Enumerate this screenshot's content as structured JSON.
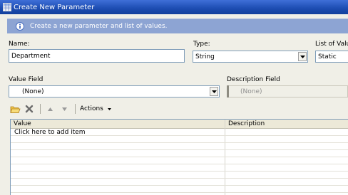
{
  "window": {
    "title": "Create New Parameter"
  },
  "banner": {
    "text": "Create a new parameter and list of values."
  },
  "form": {
    "name_label": "Name:",
    "name_value": "Department",
    "type_label": "Type:",
    "type_value": "String",
    "list_label": "List of Valu",
    "list_value": "Static",
    "value_field_label": "Value Field",
    "value_field_value": "(None)",
    "description_field_label": "Description Field",
    "description_field_value": "(None)"
  },
  "toolbar": {
    "actions_label": "Actions"
  },
  "grid": {
    "columns": [
      "Value",
      "Description"
    ],
    "rows": [
      {
        "value": "Click here to add item",
        "description": ""
      }
    ]
  },
  "colors": {
    "titlebar": "#1f4fb4",
    "banner": "#8da4d3",
    "window_bg": "#f0efe7",
    "field_border": "#7f9db9"
  }
}
